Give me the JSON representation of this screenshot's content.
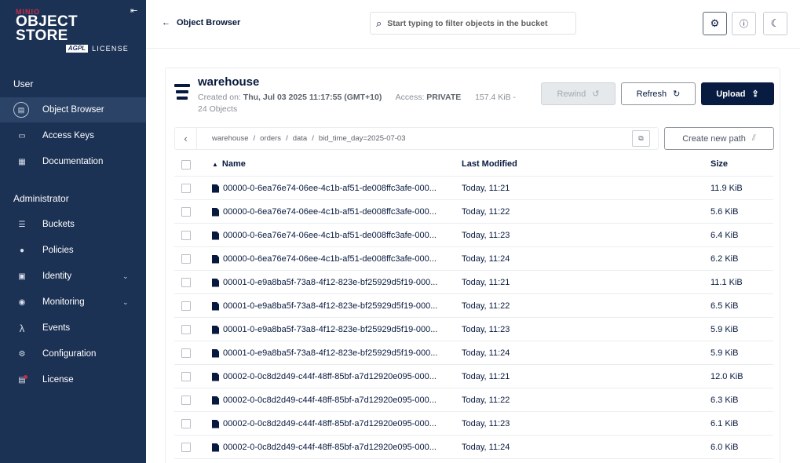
{
  "brand": {
    "minio": "MIN",
    "minio_accent": "IO",
    "product": "OBJECT STORE",
    "agpl": "AGPL",
    "license": "LICENSE"
  },
  "sidebar": {
    "user_section": "User",
    "user_items": [
      {
        "label": "Object Browser",
        "icon": "folder-icon",
        "active": true
      },
      {
        "label": "Access Keys",
        "icon": "key-icon"
      },
      {
        "label": "Documentation",
        "icon": "doc-icon"
      }
    ],
    "admin_section": "Administrator",
    "admin_items": [
      {
        "label": "Buckets",
        "icon": "bucket-icon"
      },
      {
        "label": "Policies",
        "icon": "shield-icon"
      },
      {
        "label": "Identity",
        "icon": "id-card-icon",
        "expandable": true
      },
      {
        "label": "Monitoring",
        "icon": "monitor-icon",
        "expandable": true
      },
      {
        "label": "Events",
        "icon": "lambda-icon"
      },
      {
        "label": "Configuration",
        "icon": "gear-icon"
      },
      {
        "label": "License",
        "icon": "license-icon"
      }
    ]
  },
  "topbar": {
    "back_label": "Object Browser",
    "search_placeholder": "Start typing to filter objects in the bucket"
  },
  "bucket": {
    "name": "warehouse",
    "created_label": "Created on:",
    "created_value": "Thu, Jul 03 2025 11:17:55 (GMT+10)",
    "access_label": "Access:",
    "access_value": "PRIVATE",
    "size": "157.4 KiB -",
    "objects": "24 Objects"
  },
  "actions": {
    "rewind": "Rewind",
    "refresh": "Refresh",
    "upload": "Upload",
    "new_path": "Create new path"
  },
  "path": [
    "warehouse",
    "orders",
    "data",
    "bid_time_day=2025-07-03"
  ],
  "path_sep": "/",
  "table": {
    "columns": {
      "name": "Name",
      "modified": "Last Modified",
      "size": "Size"
    },
    "rows": [
      {
        "name": "00000-0-6ea76e74-06ee-4c1b-af51-de008ffc3afe-000...",
        "modified": "Today, 11:21",
        "size": "11.9 KiB"
      },
      {
        "name": "00000-0-6ea76e74-06ee-4c1b-af51-de008ffc3afe-000...",
        "modified": "Today, 11:22",
        "size": "5.6 KiB"
      },
      {
        "name": "00000-0-6ea76e74-06ee-4c1b-af51-de008ffc3afe-000...",
        "modified": "Today, 11:23",
        "size": "6.4 KiB"
      },
      {
        "name": "00000-0-6ea76e74-06ee-4c1b-af51-de008ffc3afe-000...",
        "modified": "Today, 11:24",
        "size": "6.2 KiB"
      },
      {
        "name": "00001-0-e9a8ba5f-73a8-4f12-823e-bf25929d5f19-000...",
        "modified": "Today, 11:21",
        "size": "11.1 KiB"
      },
      {
        "name": "00001-0-e9a8ba5f-73a8-4f12-823e-bf25929d5f19-000...",
        "modified": "Today, 11:22",
        "size": "6.5 KiB"
      },
      {
        "name": "00001-0-e9a8ba5f-73a8-4f12-823e-bf25929d5f19-000...",
        "modified": "Today, 11:23",
        "size": "5.9 KiB"
      },
      {
        "name": "00001-0-e9a8ba5f-73a8-4f12-823e-bf25929d5f19-000...",
        "modified": "Today, 11:24",
        "size": "5.9 KiB"
      },
      {
        "name": "00002-0-0c8d2d49-c44f-48ff-85bf-a7d12920e095-000...",
        "modified": "Today, 11:21",
        "size": "12.0 KiB"
      },
      {
        "name": "00002-0-0c8d2d49-c44f-48ff-85bf-a7d12920e095-000...",
        "modified": "Today, 11:22",
        "size": "6.3 KiB"
      },
      {
        "name": "00002-0-0c8d2d49-c44f-48ff-85bf-a7d12920e095-000...",
        "modified": "Today, 11:23",
        "size": "6.1 KiB"
      },
      {
        "name": "00002-0-0c8d2d49-c44f-48ff-85bf-a7d12920e095-000...",
        "modified": "Today, 11:24",
        "size": "6.0 KiB"
      }
    ]
  },
  "colors": {
    "sidebar_bg": "#1c3255",
    "sidebar_active": "#2a4366",
    "primary": "#081c42",
    "accent_red": "#c72c48"
  }
}
